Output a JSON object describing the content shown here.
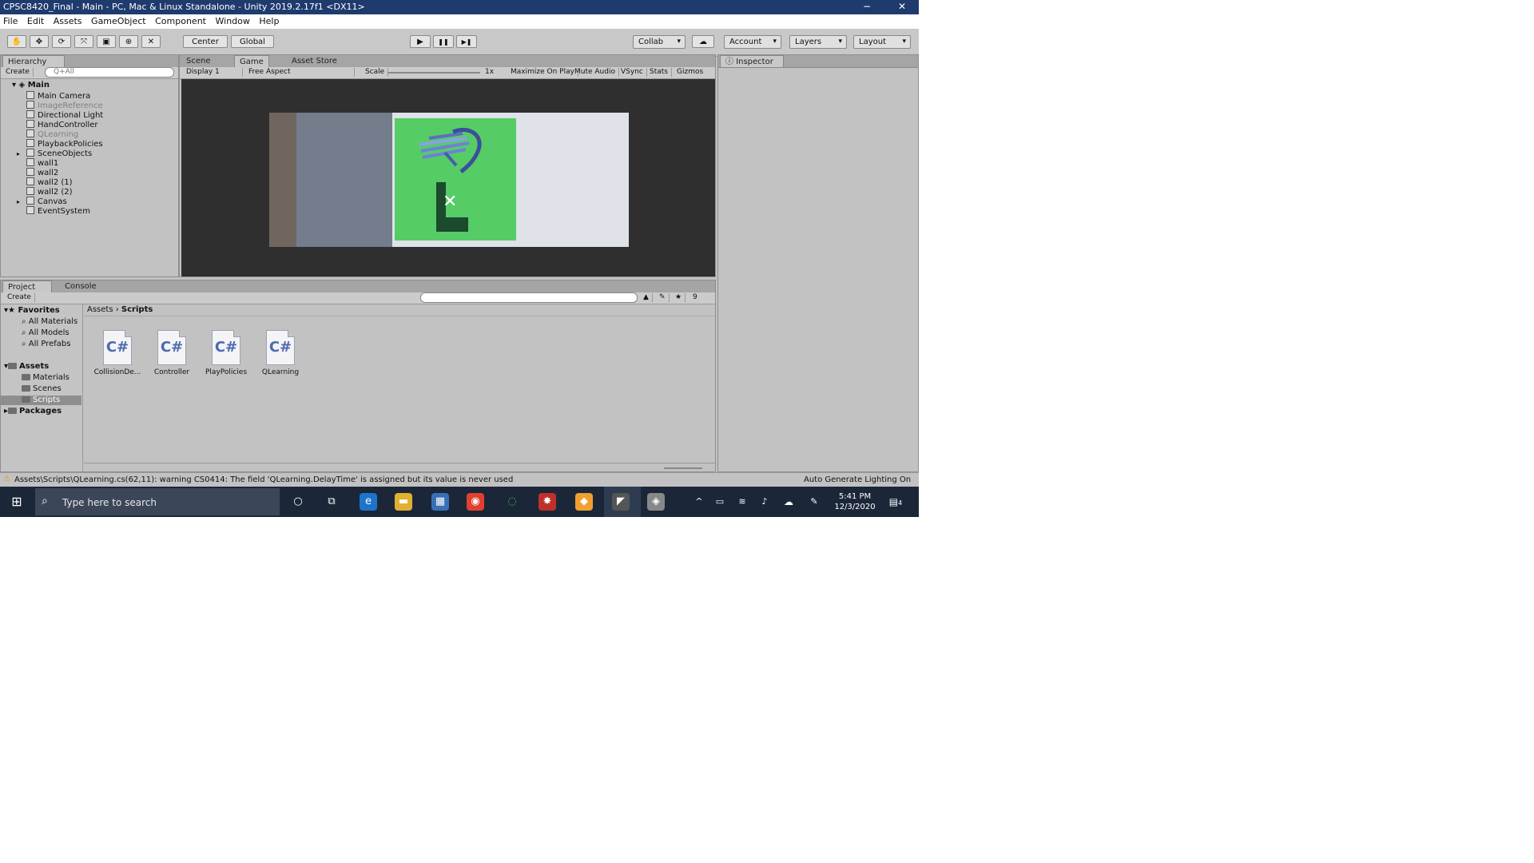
{
  "window": {
    "title": "CPSC8420_Final - Main - PC, Mac & Linux Standalone - Unity 2019.2.17f1 <DX11>",
    "minimize": "−",
    "close": "✕"
  },
  "menu": [
    "File",
    "Edit",
    "Assets",
    "GameObject",
    "Component",
    "Window",
    "Help"
  ],
  "toolbar": {
    "tools": [
      "✋",
      "✥",
      "⟳",
      "⤧",
      "▣",
      "⊕",
      "✕"
    ],
    "pivot": "Center",
    "space": "Global",
    "play": "▶",
    "pause": "❚❚",
    "step": "▶❚",
    "collab": "Collab",
    "account": "Account",
    "layers": "Layers",
    "layout": "Layout"
  },
  "hierarchy": {
    "tab": "Hierarchy",
    "create": "Create",
    "search_placeholder": "Q+All",
    "scene": "Main",
    "items": [
      {
        "label": "Main Camera",
        "dim": false,
        "arrow": false
      },
      {
        "label": "ImageReference",
        "dim": true,
        "arrow": false
      },
      {
        "label": "Directional Light",
        "dim": false,
        "arrow": false
      },
      {
        "label": "HandController",
        "dim": false,
        "arrow": false
      },
      {
        "label": "QLearning",
        "dim": true,
        "arrow": false
      },
      {
        "label": "PlaybackPolicies",
        "dim": false,
        "arrow": false
      },
      {
        "label": "SceneObjects",
        "dim": false,
        "arrow": true
      },
      {
        "label": "wall1",
        "dim": false,
        "arrow": false
      },
      {
        "label": "wall2",
        "dim": false,
        "arrow": false
      },
      {
        "label": "wall2 (1)",
        "dim": false,
        "arrow": false
      },
      {
        "label": "wall2 (2)",
        "dim": false,
        "arrow": false
      },
      {
        "label": "Canvas",
        "dim": false,
        "arrow": true
      },
      {
        "label": "EventSystem",
        "dim": false,
        "arrow": false
      }
    ]
  },
  "center_tabs": {
    "scene": "Scene",
    "game": "Game",
    "asset_store": "Asset Store"
  },
  "game_bar": {
    "display": "Display 1",
    "aspect": "Free Aspect",
    "scale_label": "Scale",
    "scale_value": "1x",
    "maximize": "Maximize On Play",
    "mute": "Mute Audio",
    "vsync": "VSync",
    "stats": "Stats",
    "gizmos": "Gizmos"
  },
  "inspector": {
    "tab": "Inspector"
  },
  "project": {
    "tab": "Project",
    "console_tab": "Console",
    "create": "Create",
    "favorites_label": "Favorites",
    "favorites": [
      "All Materials",
      "All Models",
      "All Prefabs"
    ],
    "assets_label": "Assets",
    "asset_folders": [
      "Materials",
      "Scenes",
      "Scripts"
    ],
    "packages_label": "Packages",
    "breadcrumb": [
      "Assets",
      "Scripts"
    ],
    "count": "9",
    "files": [
      {
        "icon": "C#",
        "name": "CollisionDe..."
      },
      {
        "icon": "C#",
        "name": "Controller"
      },
      {
        "icon": "C#",
        "name": "PlayPolicies"
      },
      {
        "icon": "C#",
        "name": "QLearning"
      }
    ]
  },
  "status": {
    "warning": "Assets\\Scripts\\QLearning.cs(62,11): warning CS0414: The field 'QLearning.DelayTime' is assigned but its value is never used",
    "right": "Auto Generate Lighting On"
  },
  "taskbar": {
    "search_placeholder": "Type here to search",
    "time": "5:41 PM",
    "date": "12/3/2020",
    "notifications": "4"
  },
  "colors": {
    "title_bar": "#1f3b6e",
    "game_background": "#2f2f2f",
    "green_panel": "#55cc66",
    "taskbar": "#1b2738"
  }
}
